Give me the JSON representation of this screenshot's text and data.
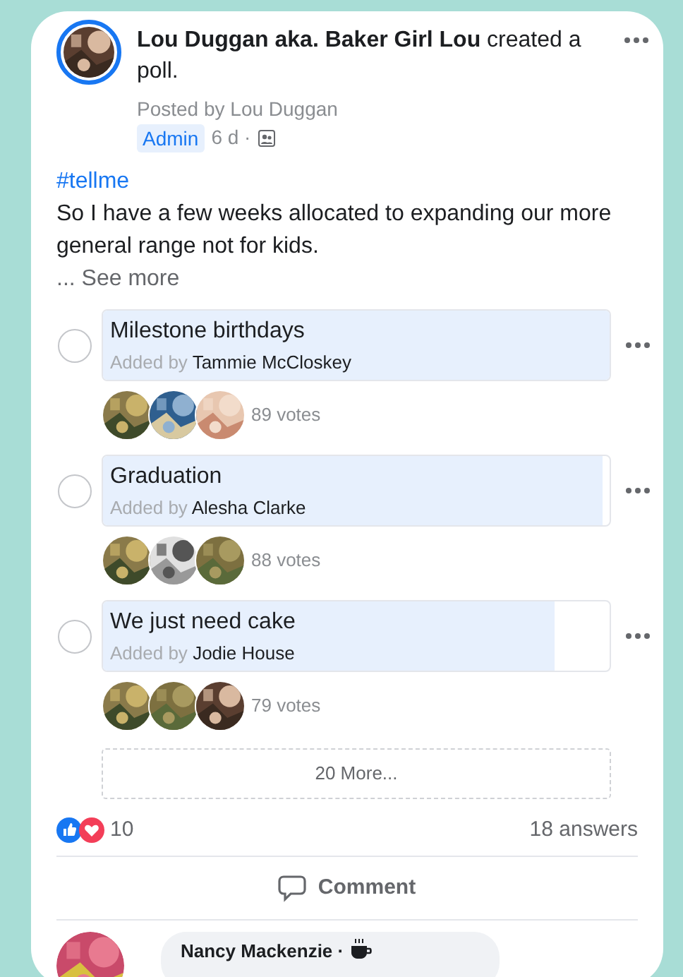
{
  "post": {
    "headline": "**Lou Duggan aka. Baker Girl Lou** created a poll.",
    "posted_by": "Posted by Lou Duggan",
    "badge": "Admin",
    "time": "6 d ·",
    "hashtag": "#tellme",
    "body": "So I have a few weeks allocated to expanding our more general range not for kids.",
    "see_more": "... See more"
  },
  "poll": {
    "options": [
      {
        "label": "Milestone birthdays",
        "added_by_prefix": "Added by",
        "added_by": "Tammie McCloskey",
        "level": 1,
        "selected": false,
        "votes": "89 votes"
      },
      {
        "label": "Graduation",
        "added_by_prefix": "Added by",
        "added_by": "Alesha Clarke",
        "level": 0.985,
        "selected": false,
        "votes": "88 votes"
      },
      {
        "label": "We just need cake",
        "added_by_prefix": "Added by",
        "added_by": "Jodie House",
        "level": 0.89,
        "selected": false,
        "votes": "79 votes"
      }
    ],
    "more": "20 More..."
  },
  "reactions": {
    "count": "10"
  },
  "answers": "18 answers",
  "actions": [
    "Comment"
  ],
  "comment": {
    "author": "Nancy Mackenzie ·"
  }
}
